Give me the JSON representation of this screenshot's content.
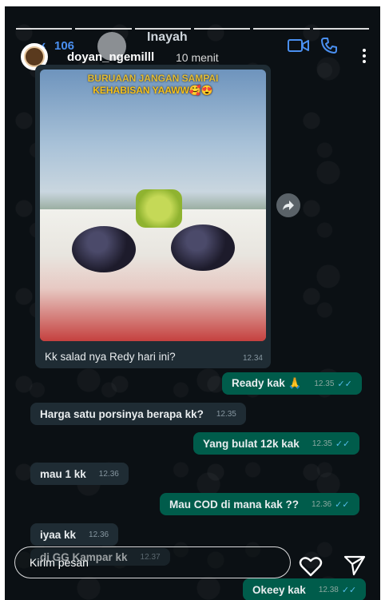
{
  "whatsapp_header": {
    "back_count": "106",
    "contact_name": "Inayah",
    "video_icon": "video-call-icon",
    "call_icon": "phone-call-icon"
  },
  "story_header": {
    "username": "doyan_ngemilll",
    "posted_ago": "10 menit",
    "more_icon": "more-vertical-icon"
  },
  "photo_message": {
    "caption_line1": "BURUAAN JANGAN SAMPAI",
    "caption_line2": "KEHABISAN YAAWW🥰😍",
    "text": "Kk salad nya Redy hari ini?",
    "time": "12.34"
  },
  "messages": [
    {
      "dir": "out",
      "text": "Ready kak 🙏",
      "time": "12.35",
      "ticks": "✓✓"
    },
    {
      "dir": "in",
      "text": "Harga satu porsinya berapa kk?",
      "time": "12.35"
    },
    {
      "dir": "out",
      "text": "Yang bulat 12k kak",
      "time": "12.35",
      "ticks": "✓✓"
    },
    {
      "dir": "in",
      "text": "mau 1 kk",
      "time": "12.36"
    },
    {
      "dir": "out",
      "text": "Mau COD di mana kak ??",
      "time": "12.36",
      "ticks": "✓✓"
    },
    {
      "dir": "in",
      "text": "iyaa kk",
      "time": "12.36"
    },
    {
      "dir": "in",
      "text": "di GG Kampar kk",
      "time": "12.37"
    },
    {
      "dir": "out",
      "text": "Okeey kak",
      "time": "12.38",
      "ticks": "✓✓"
    }
  ],
  "reply_bar": {
    "placeholder": "Kirim pesan",
    "like_icon": "heart-icon",
    "send_icon": "send-icon"
  },
  "colors": {
    "background": "#0b1014",
    "incoming_bubble": "#1f2c34",
    "outgoing_bubble": "#005c4b",
    "read_ticks": "#53bdeb",
    "whatsapp_accent": "#4a8ff0"
  }
}
